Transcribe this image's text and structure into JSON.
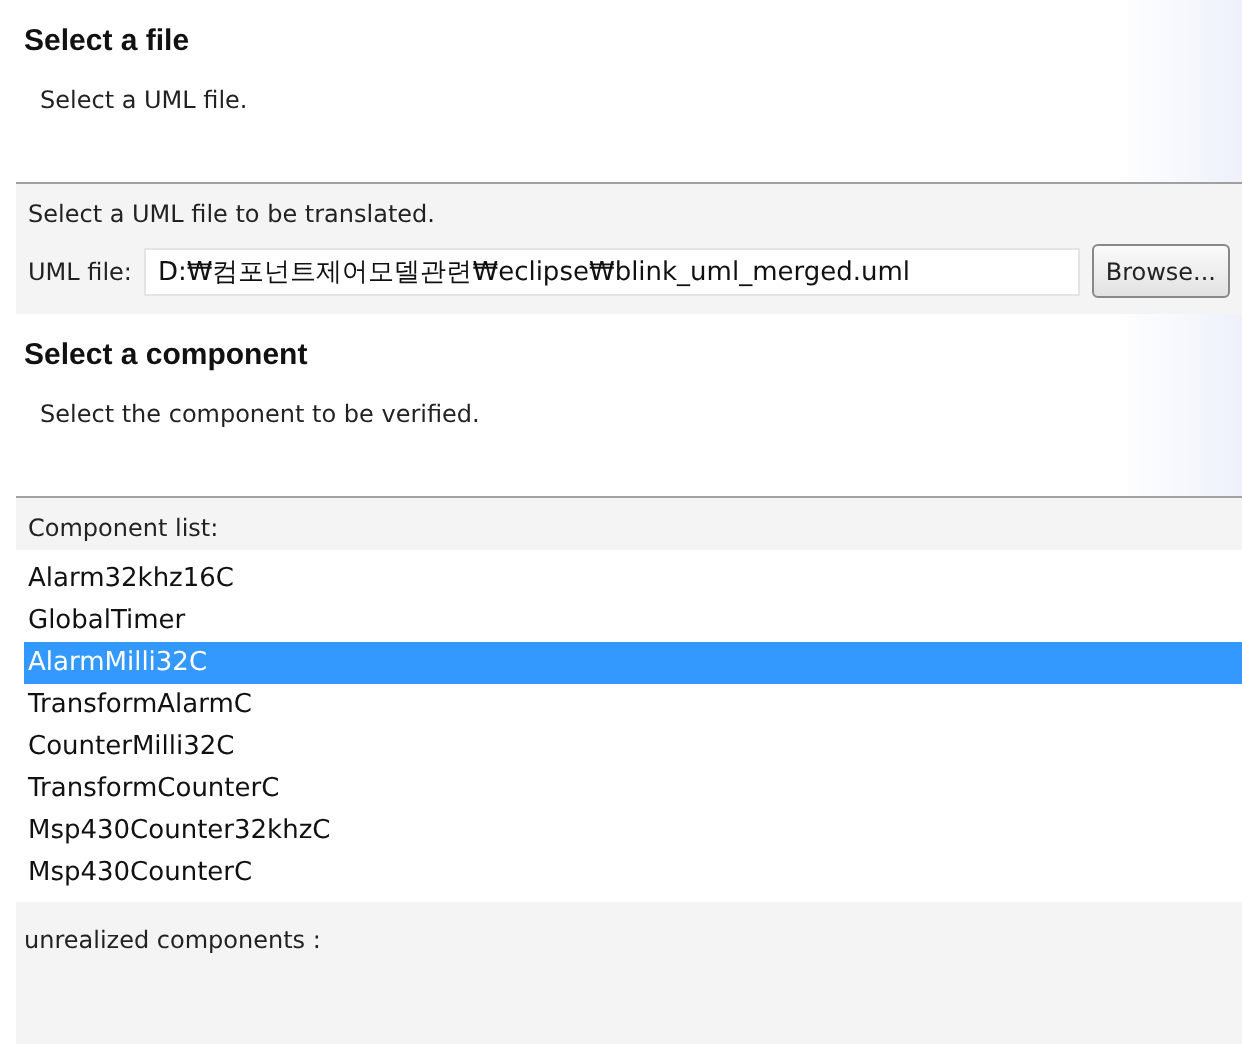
{
  "file_page": {
    "title": "Select a file",
    "description": "Select a UML file.",
    "instruction": "Select a UML file to be translated.",
    "field_label": "UML file:",
    "field_value": "D:₩컴포넌트제어모델관련₩eclipse₩blink_uml_merged.uml",
    "browse_button": "Browse..."
  },
  "component_page": {
    "title": "Select a component",
    "description": "Select the component to be verified.",
    "list_label": "Component list:",
    "components": [
      {
        "name": "Alarm32khz16C",
        "selected": false
      },
      {
        "name": "GlobalTimer",
        "selected": false
      },
      {
        "name": "AlarmMilli32C",
        "selected": true
      },
      {
        "name": "TransformAlarmC",
        "selected": false
      },
      {
        "name": "CounterMilli32C",
        "selected": false
      },
      {
        "name": "TransformCounterC",
        "selected": false
      },
      {
        "name": "Msp430Counter32khzC",
        "selected": false
      },
      {
        "name": "Msp430CounterC",
        "selected": false
      }
    ],
    "unrealized_label": "unrealized components :"
  }
}
